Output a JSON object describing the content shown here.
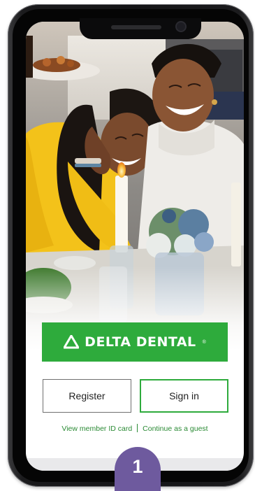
{
  "brand": {
    "name": "DELTA DENTAL",
    "registered_mark": "®",
    "logo_icon": "delta-triangle-icon",
    "color": "#2eab3c"
  },
  "actions": {
    "register_label": "Register",
    "signin_label": "Sign in"
  },
  "links": {
    "member_id": "View member ID card",
    "guest": "Continue as a guest"
  },
  "step": {
    "number": "1",
    "color": "#6e5a9e"
  },
  "hero": {
    "image": "two-women-laughing-photo"
  }
}
